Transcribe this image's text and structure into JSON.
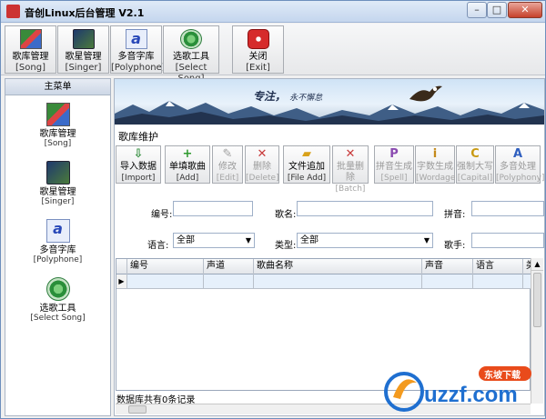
{
  "window": {
    "title": "音创Linux后台管理 V2.1"
  },
  "toolbar": [
    {
      "label": "歌库管理",
      "en": "[Song]",
      "icon": "song-library-icon"
    },
    {
      "label": "歌星管理",
      "en": "[Singer]",
      "icon": "singer-icon"
    },
    {
      "label": "多音字库",
      "en": "[Polyphone]",
      "icon": "polyphone-icon"
    },
    {
      "label": "选歌工具",
      "en": "[Select Song]",
      "icon": "select-song-icon"
    },
    {
      "label": "关闭",
      "en": "[Exit]",
      "icon": "power-icon"
    }
  ],
  "sidebar": {
    "header": "主菜单",
    "items": [
      {
        "label": "歌库管理",
        "en": "[Song]"
      },
      {
        "label": "歌星管理",
        "en": "[Singer]"
      },
      {
        "label": "多音字库",
        "en": "[Polyphone]"
      },
      {
        "label": "选歌工具",
        "en": "[Select Song]"
      }
    ]
  },
  "banner": {
    "slogan": "专注，",
    "slogan_small": "永不懈怠"
  },
  "section_title": "歌库维护",
  "actions": [
    {
      "label": "导入数据",
      "en": "[Import]",
      "enabled": true,
      "icon": "import-icon",
      "glyph": "⇩",
      "color": "#2e8b3a"
    },
    {
      "label": "单填歌曲",
      "en": "[Add]",
      "enabled": true,
      "icon": "add-icon",
      "glyph": "+",
      "color": "#2e9a2e"
    },
    {
      "label": "修改",
      "en": "[Edit]",
      "enabled": false,
      "icon": "edit-icon",
      "glyph": "✎",
      "color": "#a0a0a0"
    },
    {
      "label": "删除",
      "en": "[Delete]",
      "enabled": false,
      "icon": "delete-icon",
      "glyph": "✕",
      "color": "#c83a3a"
    },
    {
      "label": "文件追加",
      "en": "[File Add]",
      "enabled": true,
      "icon": "folder-icon",
      "glyph": "▰",
      "color": "#d9a21b"
    },
    {
      "label": "批量删除",
      "en": "[Batch]",
      "enabled": false,
      "icon": "batch-delete-icon",
      "glyph": "✕",
      "color": "#c83a3a"
    },
    {
      "label": "拼音生成",
      "en": "[Spell]",
      "enabled": false,
      "icon": "spell-icon",
      "glyph": "P",
      "color": "#8a4ab0"
    },
    {
      "label": "字数生成",
      "en": "[Wordage]",
      "enabled": false,
      "icon": "wordage-icon",
      "glyph": "i",
      "color": "#c48a1a"
    },
    {
      "label": "强制大写",
      "en": "[Capital]",
      "enabled": false,
      "icon": "capital-icon",
      "glyph": "C",
      "color": "#c99a12"
    },
    {
      "label": "多音处理",
      "en": "[Polyphony]",
      "enabled": false,
      "icon": "polyphony-icon",
      "glyph": "A",
      "color": "#2f5fbf"
    }
  ],
  "form": {
    "id_label": "编号:",
    "name_label": "歌名:",
    "pinyin_label": "拼音:",
    "lang_label": "语言:",
    "lang_value": "全部",
    "type_label": "类型:",
    "type_value": "全部",
    "singer_label": "歌手:"
  },
  "table": {
    "columns": [
      "编号",
      "声道",
      "歌曲名称",
      "声音",
      "语言",
      "类"
    ]
  },
  "status": "数据库共有0条记录",
  "watermark": {
    "cn": "东坡下载",
    "brand": "uzzf.com"
  }
}
